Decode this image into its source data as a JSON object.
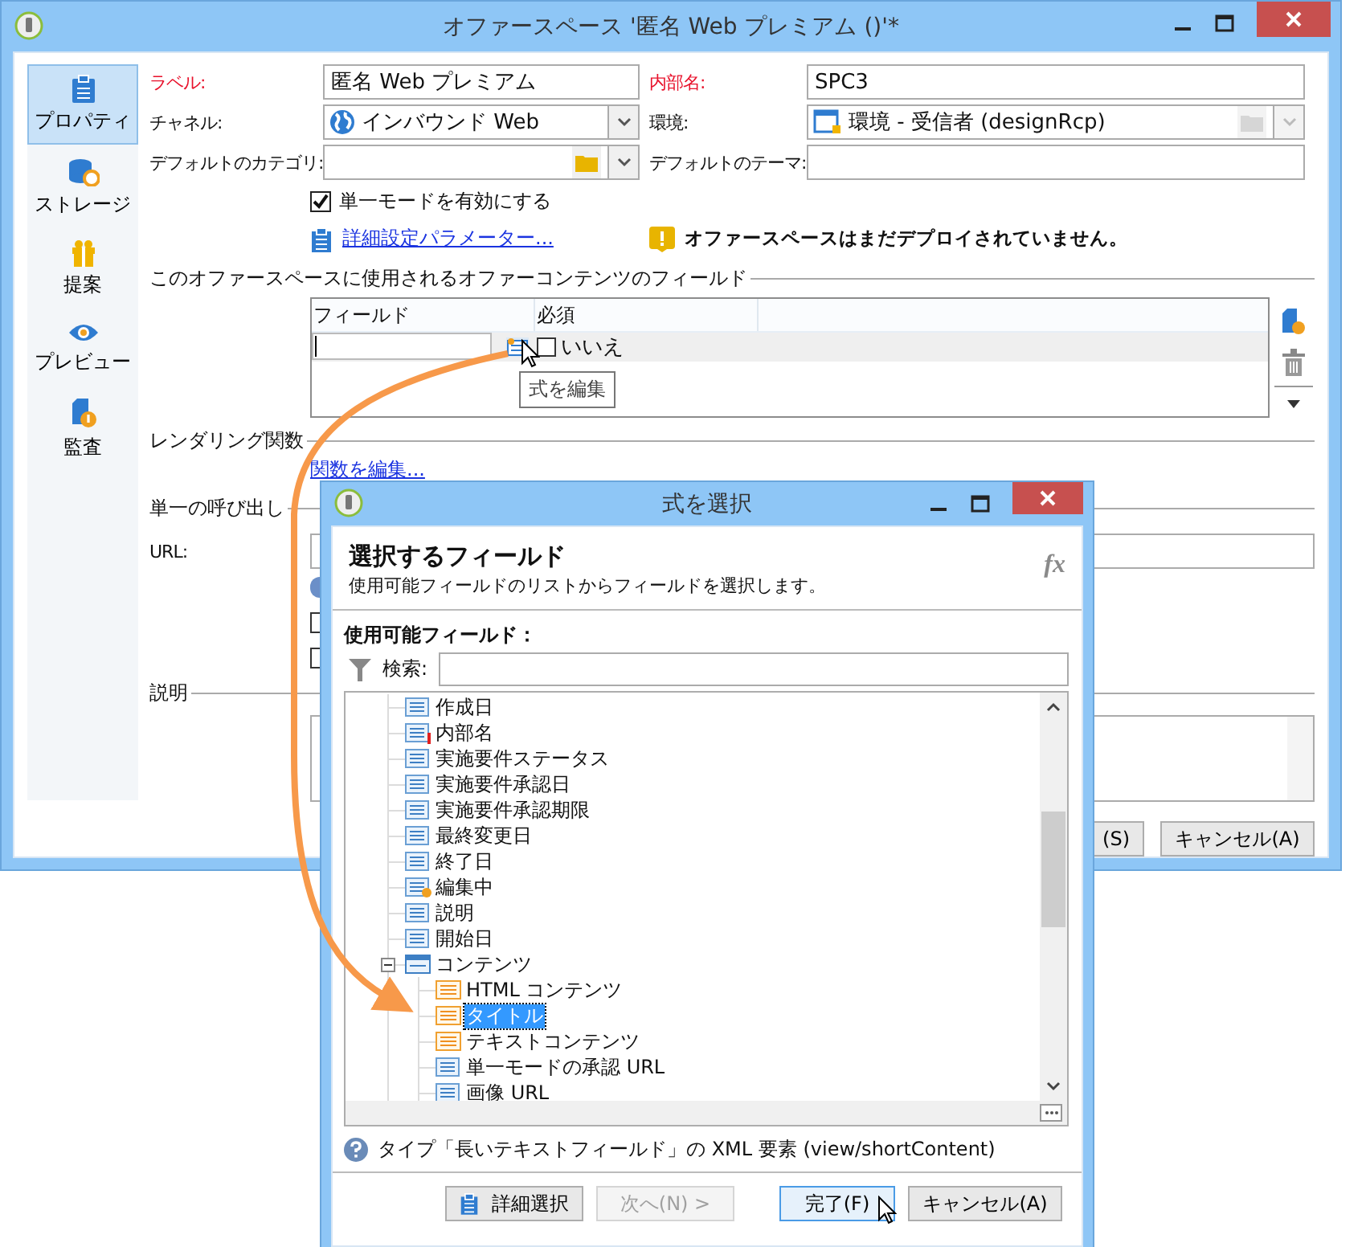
{
  "main_window": {
    "title": "オファースペース '匿名 Web プレミアム ()'*",
    "nav": [
      {
        "label": "プロパティ",
        "selected": true
      },
      {
        "label": "ストレージ",
        "selected": false
      },
      {
        "label": "提案",
        "selected": false
      },
      {
        "label": "プレビュー",
        "selected": false
      },
      {
        "label": "監査",
        "selected": false
      }
    ],
    "fields": [
      {
        "label": "ラベル:",
        "value": "匿名 Web プレミアム",
        "required": true,
        "kind": "text",
        "disabled": false
      },
      {
        "label": "内部名:",
        "value": "SPC3",
        "required": true,
        "kind": "text",
        "disabled": false
      },
      {
        "label": "チャネル:",
        "value": "インバウンド Web",
        "required": false,
        "kind": "combo",
        "disabled": false
      },
      {
        "label": "環境:",
        "value": "環境 - 受信者 (designRcp)",
        "required": false,
        "kind": "picker",
        "disabled": true
      },
      {
        "label": "デフォルトのカテゴリ:",
        "required": false,
        "kind": "picker",
        "disabled": false
      },
      {
        "label": "デフォルトのテーマ:",
        "required": false,
        "kind": "text",
        "disabled": false
      }
    ],
    "single_mode": {
      "label": "単一モードを有効にする",
      "checked": true
    },
    "advanced_link": "詳細設定パラメーター...",
    "warning": "オファースペースはまだデプロイされていません。",
    "content_fields": {
      "title": "このオファースペースに使用されるオファーコンテンツのフィールド",
      "columns": [
        "フィールド",
        "必須"
      ],
      "rows": [
        {
          "required": "いいえ",
          "checked": false
        }
      ],
      "tooltip": "式を編集"
    },
    "rendering": {
      "title": "レンダリング関数",
      "link": "関数を編集..."
    },
    "single_call": {
      "title": "単一の呼び出し",
      "url_label": "URL:",
      "options": [
        {
          "kind": "radio",
          "checked": true
        },
        {
          "kind": "checkbox",
          "checked": false
        },
        {
          "kind": "checkbox",
          "checked": false
        }
      ]
    },
    "description": {
      "title": "説明"
    },
    "buttons": [
      {
        "label": "(S)"
      },
      {
        "label": "キャンセル(A)"
      }
    ]
  },
  "dialog": {
    "title": "式を選択",
    "heading": "選択するフィールド",
    "subtitle": "使用可能フィールドのリストからフィールドを選択します。",
    "fx": "fx",
    "list_label": "使用可能フィールド：",
    "search_label": "検索:",
    "tree": [
      {
        "label": "作成日",
        "kind": "field",
        "selected": false
      },
      {
        "label": "内部名",
        "kind": "mandatory",
        "selected": false
      },
      {
        "label": "実施要件ステータス",
        "kind": "field",
        "selected": false
      },
      {
        "label": "実施要件承認日",
        "kind": "field",
        "selected": false
      },
      {
        "label": "実施要件承認期限",
        "kind": "field",
        "selected": false
      },
      {
        "label": "最終変更日",
        "kind": "field",
        "selected": false
      },
      {
        "label": "終了日",
        "kind": "field",
        "selected": false
      },
      {
        "label": "編集中",
        "kind": "computed",
        "selected": false
      },
      {
        "label": "説明",
        "kind": "field",
        "selected": false
      },
      {
        "label": "開始日",
        "kind": "field",
        "selected": false
      },
      {
        "label": "コンテンツ",
        "kind": "group",
        "selected": false,
        "expanded": true,
        "children": [
          {
            "label": "HTML コンテンツ",
            "kind": "xml",
            "selected": false
          },
          {
            "label": "タイトル",
            "kind": "xml",
            "selected": true
          },
          {
            "label": "テキストコンテンツ",
            "kind": "xml",
            "selected": false
          },
          {
            "label": "単一モードの承認 URL",
            "kind": "field",
            "selected": false
          },
          {
            "label": "画像 URL",
            "kind": "field",
            "selected": false
          }
        ]
      }
    ],
    "help": "タイプ「長いテキストフィールド」の XML 要素 (view/shortContent)",
    "buttons": [
      {
        "label": "詳細選択",
        "disabled": false,
        "default": false
      },
      {
        "label": "次へ(N) >",
        "disabled": true,
        "default": false
      },
      {
        "label": "完了(F)",
        "disabled": false,
        "default": true
      },
      {
        "label": "キャンセル(A)",
        "disabled": false,
        "default": false
      }
    ]
  }
}
